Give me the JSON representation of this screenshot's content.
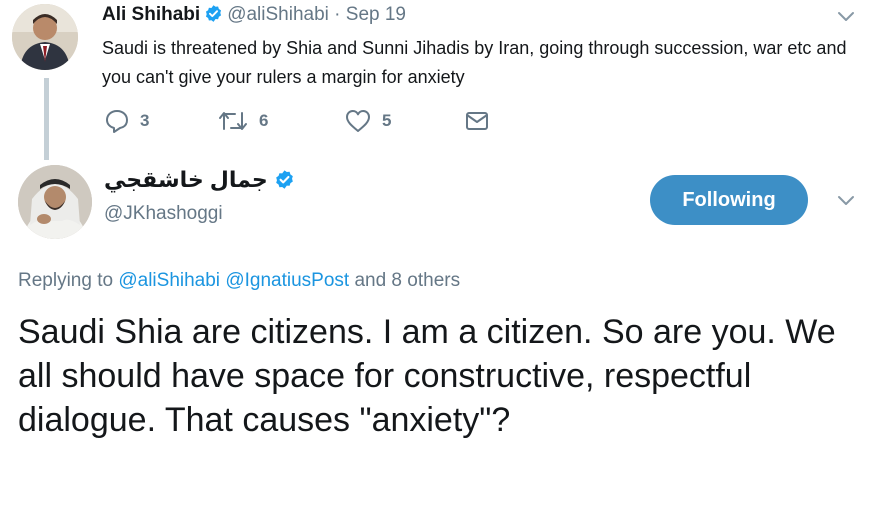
{
  "parent_tweet": {
    "author_name": "Ali Shihabi",
    "handle": "@aliShihabi",
    "separator": "·",
    "date": "Sep 19",
    "text": "Saudi is threatened by Shia and Sunni Jihadis by Iran, going through succession, war etc and you can't give your rulers a margin for anxiety",
    "actions": {
      "reply_count": "3",
      "retweet_count": "6",
      "like_count": "5"
    }
  },
  "main_tweet": {
    "author_name": "جمال خاشقجي",
    "handle": "@JKhashoggi",
    "follow_label": "Following",
    "replying": {
      "prefix": "Replying to",
      "mention1": "@aliShihabi",
      "mention2": "@IgnatiusPost",
      "suffix": "and 8 others"
    },
    "text": "Saudi Shia are citizens. I am a citizen. So are you. We all should have space for constructive, respectful dialogue. That causes \"anxiety\"?"
  },
  "colors": {
    "link": "#1b95e0",
    "follow_button": "#3d8fc6",
    "muted": "#657786",
    "thread_line": "#c4cfd6"
  },
  "icons": [
    "verified-badge-icon",
    "chevron-down-icon",
    "reply-icon",
    "retweet-icon",
    "like-icon",
    "direct-message-icon"
  ]
}
